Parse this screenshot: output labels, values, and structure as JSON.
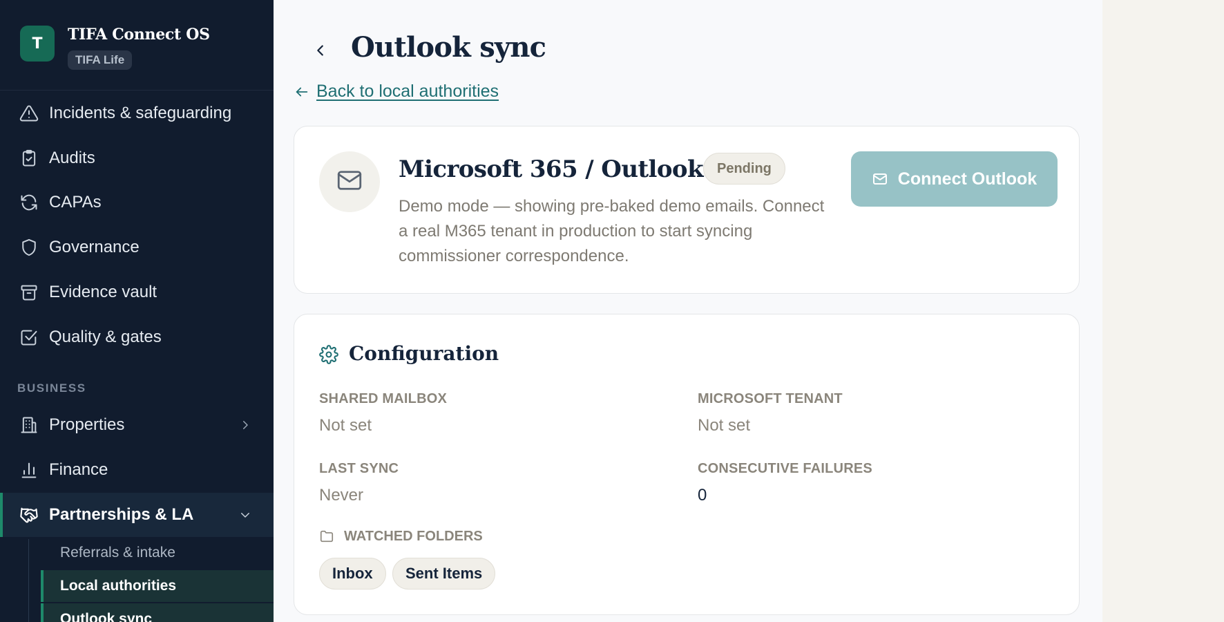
{
  "brand": {
    "initial": "T",
    "name": "TIFA Connect OS",
    "badge": "TIFA Life"
  },
  "sidebar": {
    "items": [
      {
        "label": "Incidents & safeguarding",
        "icon": "alert-triangle-icon"
      },
      {
        "label": "Audits",
        "icon": "clipboard-check-icon"
      },
      {
        "label": "CAPAs",
        "icon": "refresh-icon"
      },
      {
        "label": "Governance",
        "icon": "shield-icon"
      },
      {
        "label": "Evidence vault",
        "icon": "archive-icon"
      },
      {
        "label": "Quality & gates",
        "icon": "checkbox-icon"
      }
    ],
    "section_label": "BUSINESS",
    "business_items": [
      {
        "label": "Properties",
        "icon": "building-icon"
      },
      {
        "label": "Finance",
        "icon": "bar-chart-icon"
      },
      {
        "label": "Partnerships & LA",
        "icon": "handshake-icon"
      }
    ],
    "sub_items": [
      {
        "label": "Referrals & intake"
      },
      {
        "label": "Local authorities"
      },
      {
        "label": "Outlook sync"
      }
    ]
  },
  "header": {
    "title": "Outlook sync",
    "back_link": "Back to local authorities"
  },
  "provider": {
    "title": "Microsoft 365 / Outlook",
    "status": "Pending",
    "description": "Demo mode — showing pre-baked demo emails. Connect a real M365 tenant in production to start syncing commissioner correspondence.",
    "connect_label": "Connect Outlook"
  },
  "config": {
    "title": "Configuration",
    "fields": {
      "shared_mailbox": {
        "label": "SHARED MAILBOX",
        "value": "Not set"
      },
      "microsoft_tenant": {
        "label": "MICROSOFT TENANT",
        "value": "Not set"
      },
      "last_sync": {
        "label": "LAST SYNC",
        "value": "Never"
      },
      "consecutive_failures": {
        "label": "CONSECUTIVE FAILURES",
        "value": "0"
      }
    },
    "watched_folders_label": "WATCHED FOLDERS",
    "folders": [
      "Inbox",
      "Sent Items"
    ]
  },
  "colors": {
    "sidebar_bg": "#111c2e",
    "accent_green": "#1e8a6a",
    "link_teal": "#1f6f73",
    "connect_button": "#97c2c6"
  }
}
